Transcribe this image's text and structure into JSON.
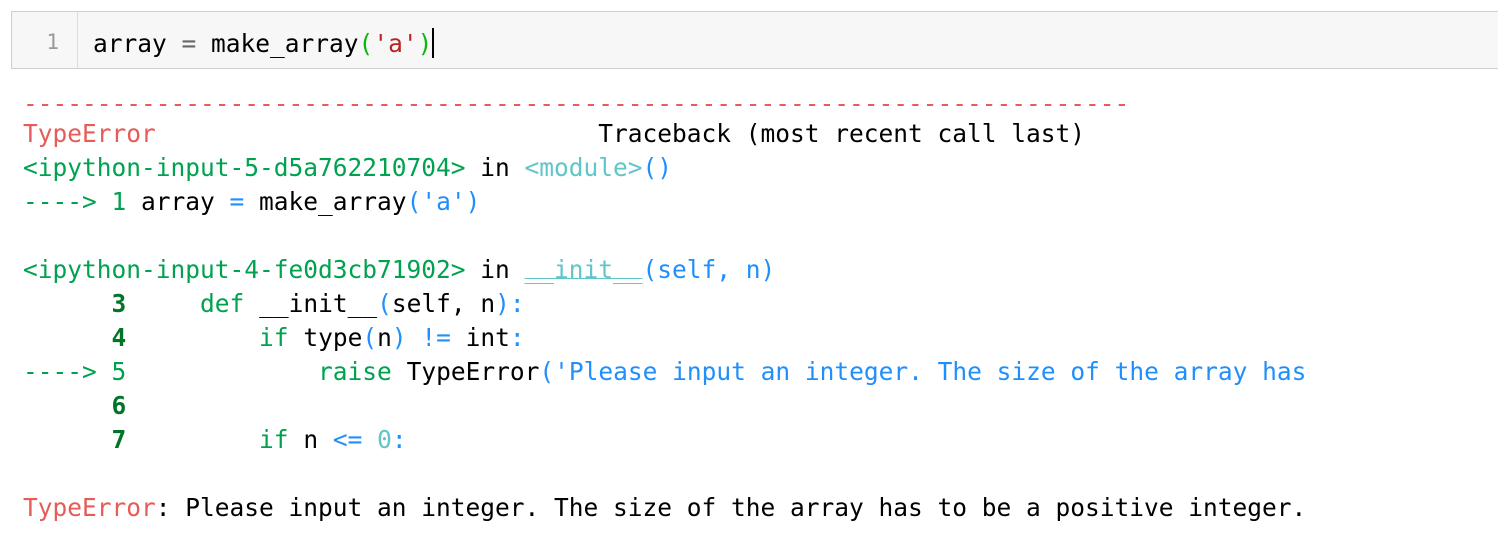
{
  "input_cell": {
    "line_number": "1",
    "code": {
      "identifier": "array",
      "op": " = ",
      "func": "make_array",
      "open_paren": "(",
      "string": "'a'",
      "close_paren": ")"
    }
  },
  "traceback": {
    "separator": "---------------------------------------------------------------------------",
    "error_type": "TypeError",
    "header_text": "Traceback (most recent call last)",
    "header_pad": "                              ",
    "frame1": {
      "location": "<ipython-input-5-d5a762210704>",
      "in_word": " in ",
      "scope": "<module>",
      "parens": "()",
      "arrow": "----> 1 ",
      "code_ident": "array",
      "code_op": " = ",
      "code_func": "make_array",
      "code_open": "(",
      "code_str": "'a'",
      "code_close": ")"
    },
    "frame2": {
      "location": "<ipython-input-4-fe0d3cb71902>",
      "in_word": " in ",
      "scope": "__init__",
      "params": "(self, n)",
      "lines": [
        {
          "prefix": "      ",
          "num": "3",
          "indent": "     ",
          "kw": "def",
          "rest": " __init__",
          "p_open": "(",
          "args": "self, n",
          "p_close": "):"
        },
        {
          "prefix": "      ",
          "num": "4",
          "indent": "         ",
          "kw": "if",
          "rest": " type",
          "p_open": "(",
          "args": "n",
          "p_close": ")",
          "tail_op": " != ",
          "tail": "int",
          "tail_colon": ":"
        },
        {
          "prefix": "----> ",
          "num": "5",
          "indent": "             ",
          "kw": "raise",
          "rest": " TypeError",
          "p_open": "(",
          "str": "'Please input an integer. The size of the array has"
        },
        {
          "prefix": "      ",
          "num": "6"
        },
        {
          "prefix": "      ",
          "num": "7",
          "indent": "         ",
          "kw": "if",
          "rest": " n ",
          "op": "<=",
          "val": " 0",
          "colon": ":"
        }
      ]
    },
    "final": {
      "error_type": "TypeError",
      "message": ": Please input an integer. The size of the array has to be a positive integer."
    }
  },
  "colors": {
    "error_red": "#e75c58",
    "location_green": "#00a250",
    "module_cyan": "#60c6c8",
    "keyword_blue": "#208ffb",
    "lineno_green": "#007427",
    "string_red": "#ba2121"
  }
}
